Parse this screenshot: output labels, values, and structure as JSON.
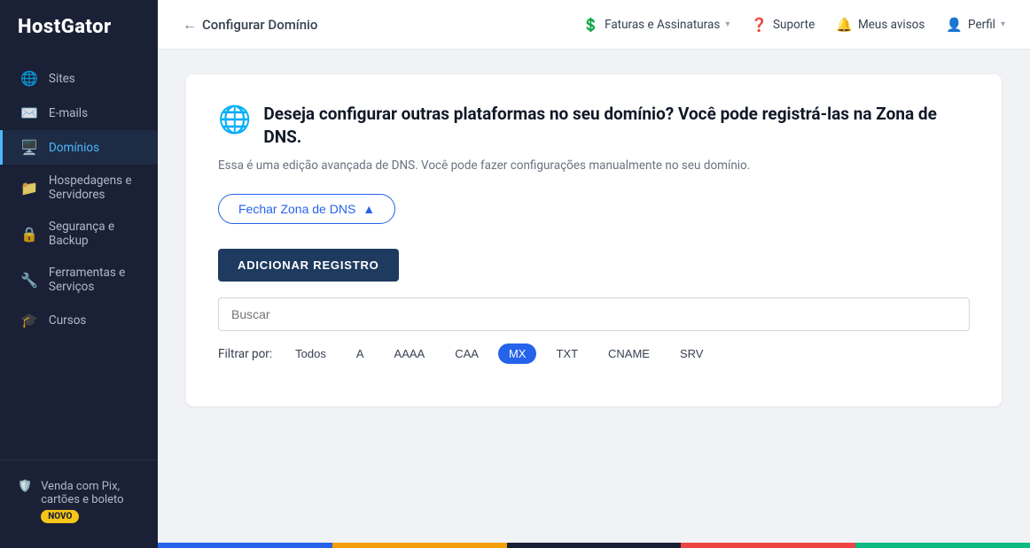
{
  "sidebar": {
    "logo": "HostGator",
    "items": [
      {
        "id": "sites",
        "label": "Sites",
        "icon": "🌐"
      },
      {
        "id": "emails",
        "label": "E-mails",
        "icon": "✉️"
      },
      {
        "id": "dominios",
        "label": "Domínios",
        "icon": "🖥️",
        "active": true
      },
      {
        "id": "hospedagens",
        "label": "Hospedagens e Servidores",
        "icon": "📁"
      },
      {
        "id": "seguranca",
        "label": "Segurança e Backup",
        "icon": "🔒"
      },
      {
        "id": "ferramentas",
        "label": "Ferramentas e Serviços",
        "icon": "🔧"
      },
      {
        "id": "cursos",
        "label": "Cursos",
        "icon": "🎓"
      }
    ],
    "bottom": {
      "label": "Venda com Pix, cartões e boleto",
      "badge": "NOVO",
      "icon": "🛡️"
    }
  },
  "topnav": {
    "back_label": "Configurar Domínio",
    "faturas_label": "Faturas e Assinaturas",
    "suporte_label": "Suporte",
    "avisos_label": "Meus avisos",
    "perfil_label": "Perfil"
  },
  "card": {
    "title": "Deseja configurar outras plataformas no seu domínio? Você pode registrá-las na Zona de DNS.",
    "subtitle": "Essa é uma edição avançada de DNS. Você pode fazer configurações manualmente no seu domínio.",
    "fechar_btn": "Fechar Zona de DNS",
    "adicionar_btn": "ADICIONAR REGISTRO",
    "search_placeholder": "Buscar",
    "filter_label": "Filtrar por:",
    "filters": [
      {
        "id": "todos",
        "label": "Todos",
        "active": false
      },
      {
        "id": "a",
        "label": "A",
        "active": false
      },
      {
        "id": "aaaa",
        "label": "AAAA",
        "active": false
      },
      {
        "id": "caa",
        "label": "CAA",
        "active": false
      },
      {
        "id": "mx",
        "label": "MX",
        "active": true
      },
      {
        "id": "txt",
        "label": "TXT",
        "active": false
      },
      {
        "id": "cname",
        "label": "CNAME",
        "active": false
      },
      {
        "id": "srv",
        "label": "SRV",
        "active": false
      }
    ]
  }
}
